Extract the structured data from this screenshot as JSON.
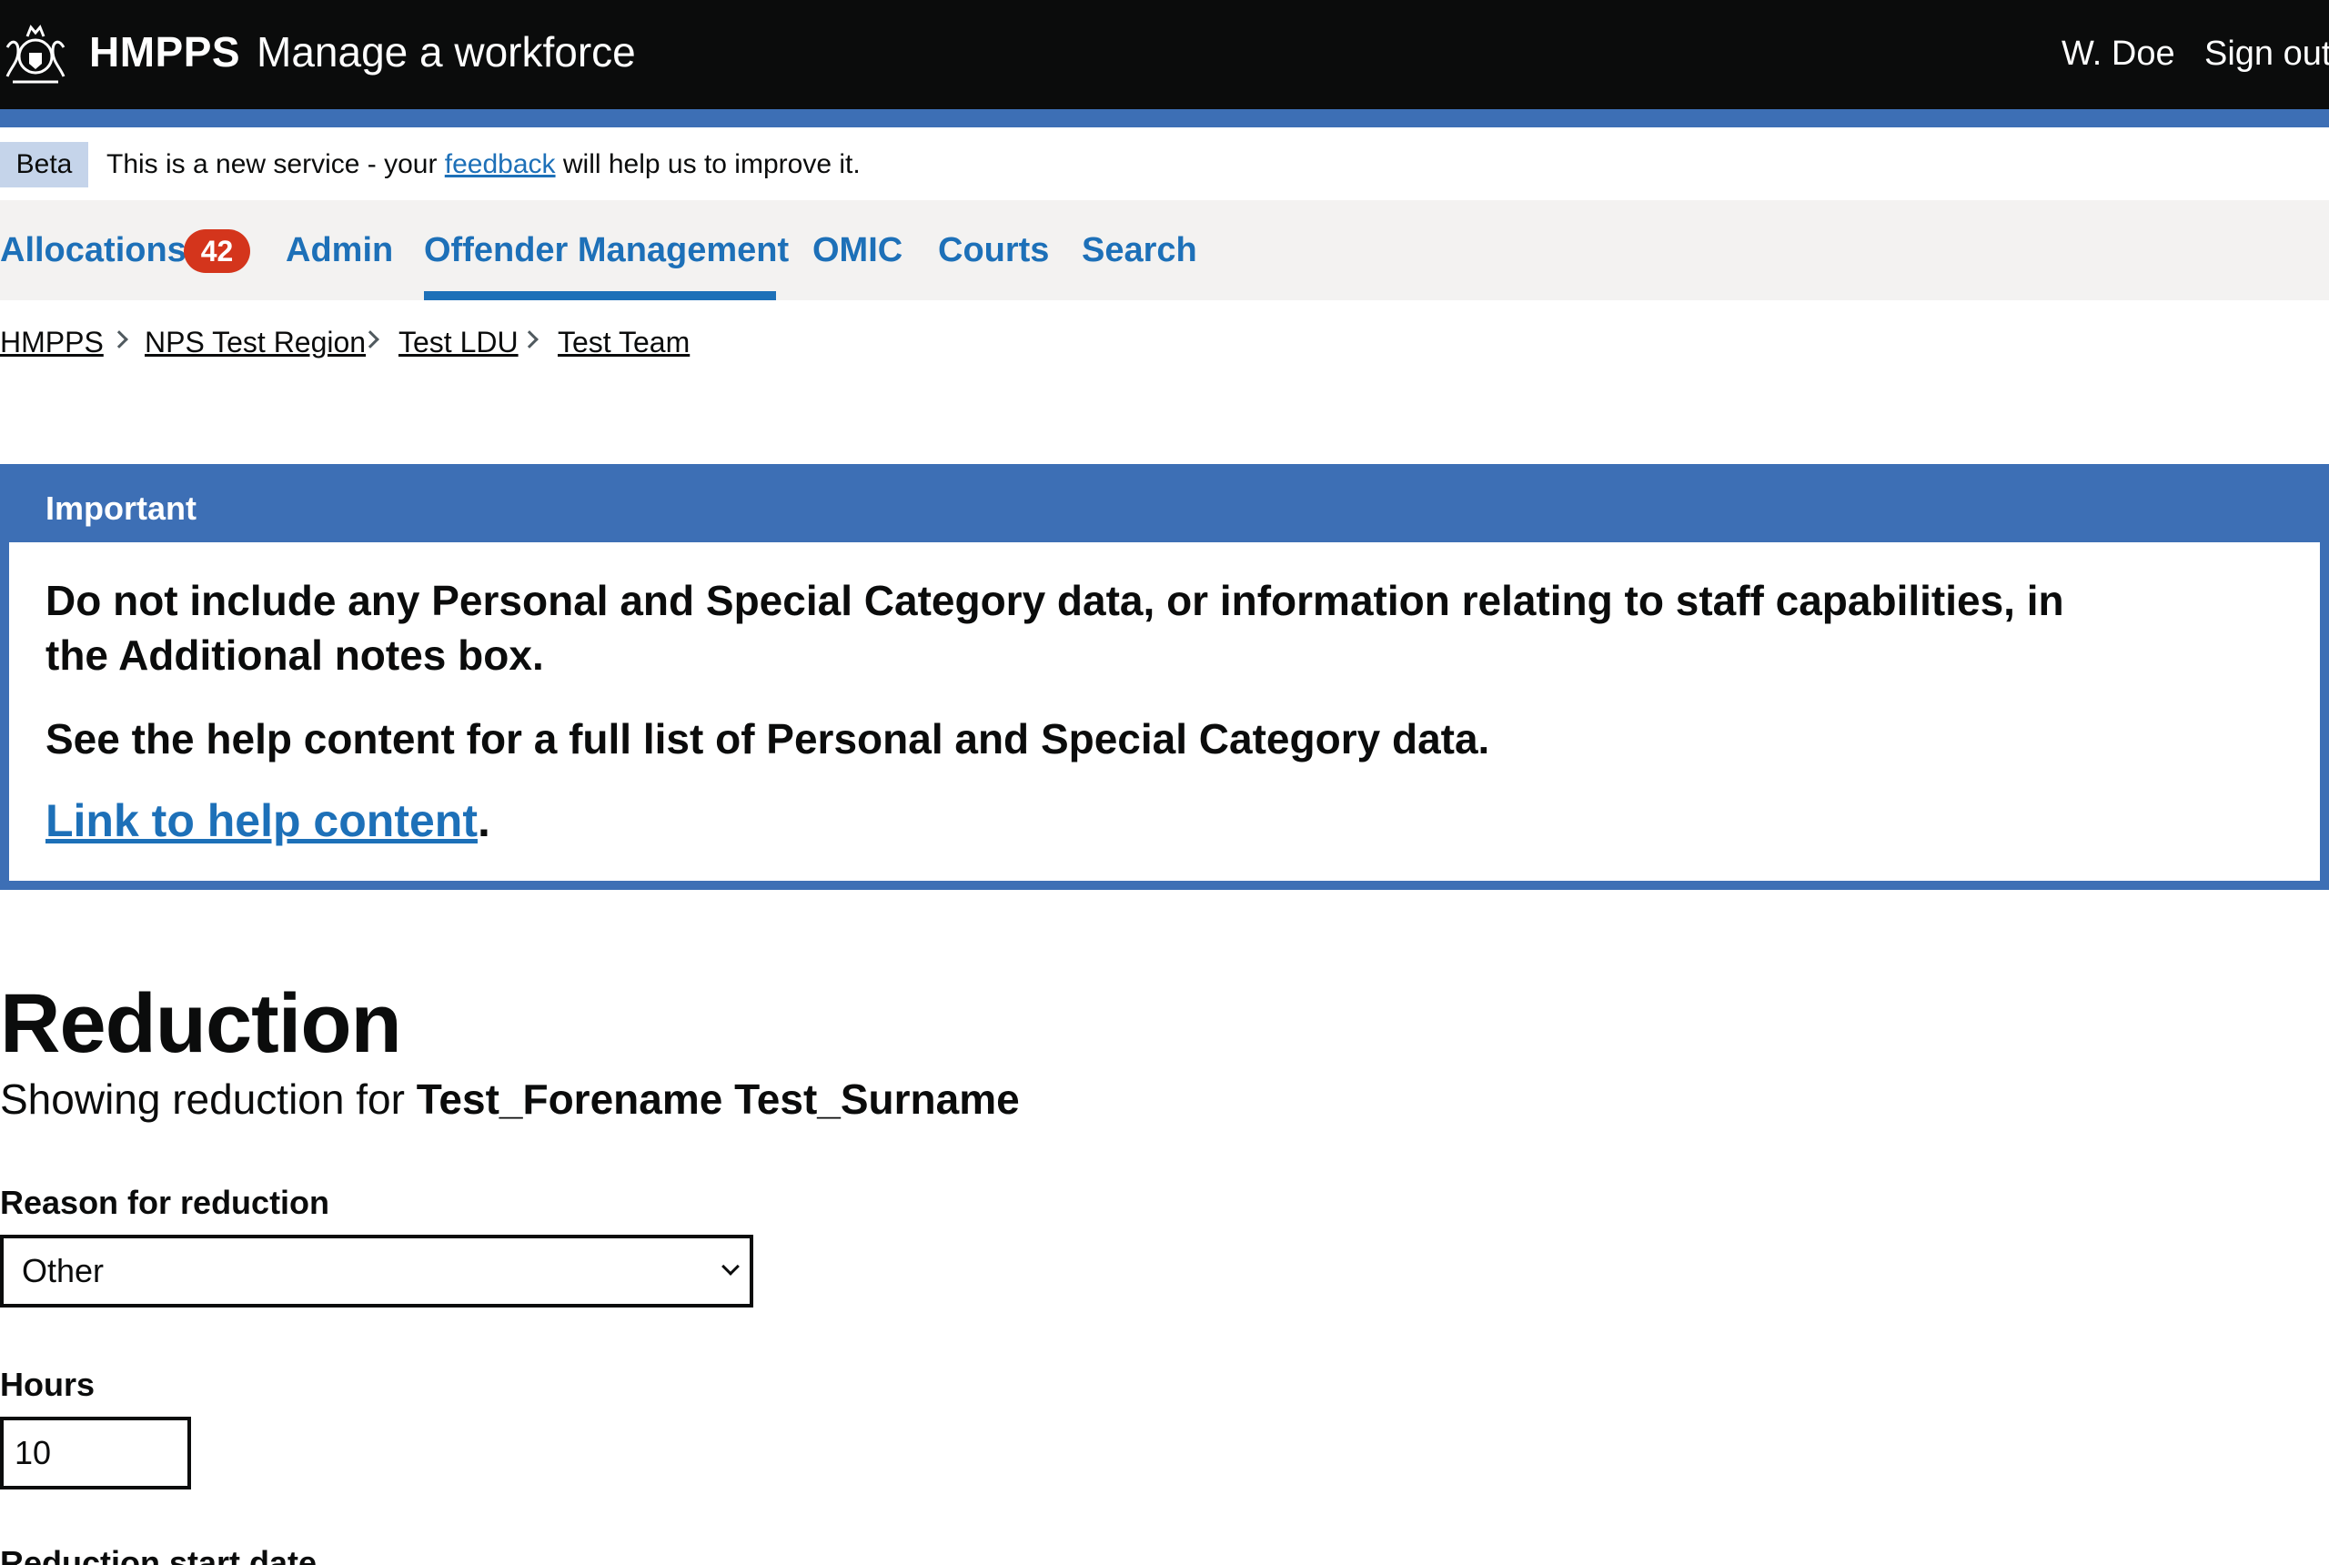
{
  "header": {
    "brand": "HMPPS",
    "service_name": "Manage a workforce",
    "user_name": "W. Doe",
    "sign_out": "Sign out"
  },
  "beta_banner": {
    "tag": "Beta",
    "text_before": "This is a new service - your ",
    "link": "feedback",
    "text_after": " will help us to improve it."
  },
  "nav": {
    "items": [
      {
        "label": "Allocations",
        "badge": "42"
      },
      {
        "label": "Admin"
      },
      {
        "label": "Offender Management",
        "active": true
      },
      {
        "label": "OMIC"
      },
      {
        "label": "Courts"
      },
      {
        "label": "Search"
      }
    ]
  },
  "breadcrumbs": [
    "HMPPS",
    "NPS Test Region",
    "Test LDU",
    "Test Team"
  ],
  "important": {
    "title": "Important",
    "line1": "Do not include any Personal and Special Category data, or information relating to staff capabilities, in the Additional notes box.",
    "line2": "See the help content for a full list of Personal and Special Category data.",
    "link": "Link to help content",
    "link_suffix": "."
  },
  "page": {
    "title": "Reduction",
    "subtitle_prefix": "Showing reduction for ",
    "subtitle_name": "Test_Forename Test_Surname"
  },
  "form": {
    "reason_label": "Reason for reduction",
    "reason_value": "Other",
    "hours_label": "Hours",
    "hours_value": "10",
    "start_date_label": "Reduction start date"
  },
  "colors": {
    "header_bg": "#0b0c0c",
    "accent_blue": "#3d6fb5",
    "link_blue": "#1d70b8",
    "badge_red": "#d4351c",
    "nav_bg": "#f3f2f1"
  }
}
